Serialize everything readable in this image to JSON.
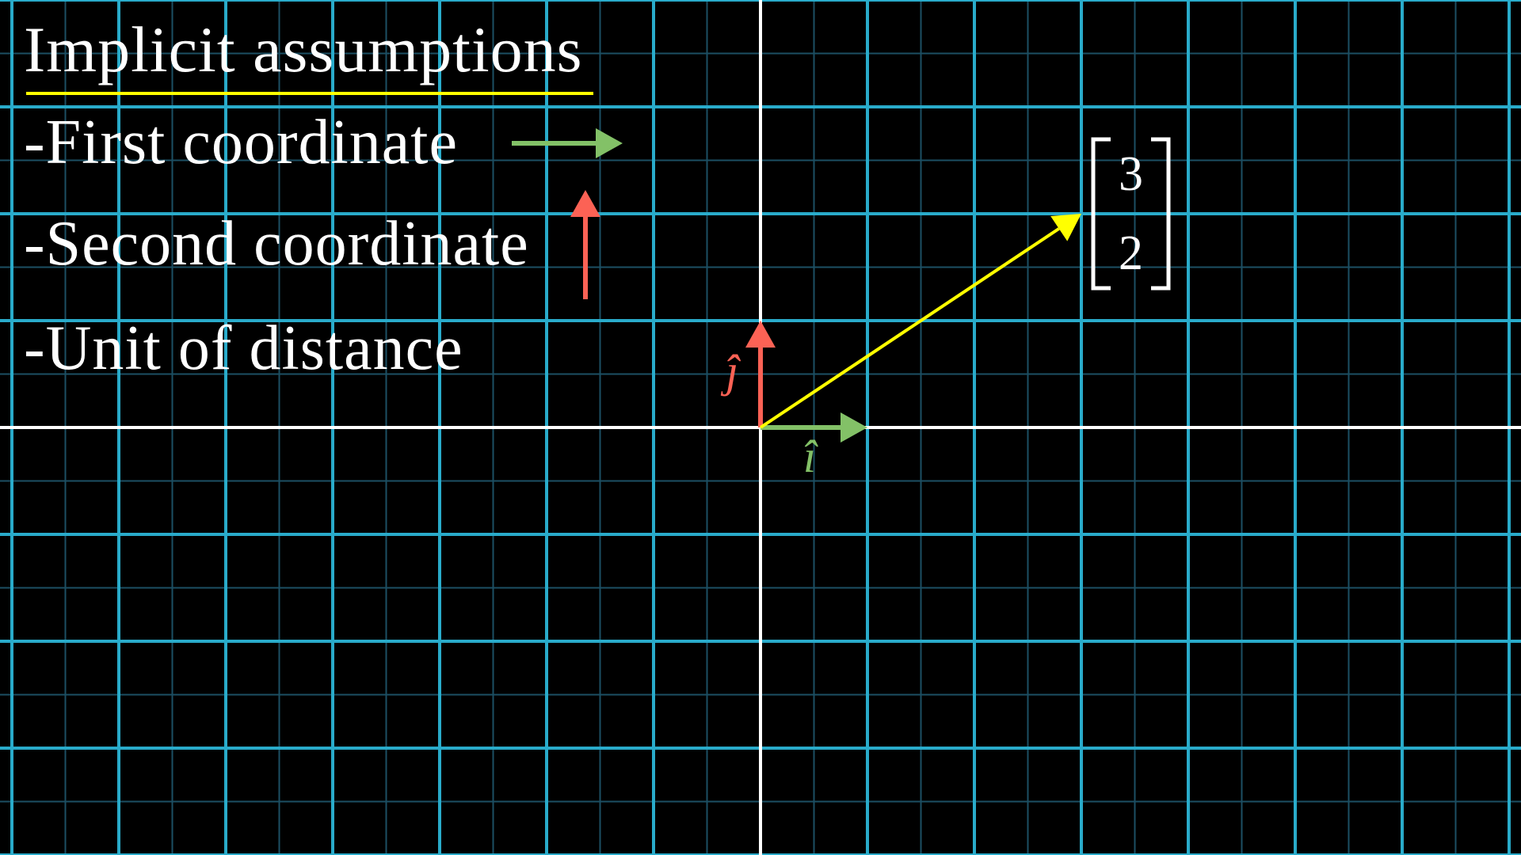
{
  "title": "Implicit assumptions",
  "assumptions": [
    {
      "label": "-First coordinate"
    },
    {
      "label": "-Second coordinate"
    },
    {
      "label": "-Unit of distance"
    }
  ],
  "basis": {
    "i_hat_label": "î",
    "j_hat_label": "ĵ"
  },
  "vector": {
    "x": 3,
    "y": 2,
    "entries": [
      "3",
      "2"
    ]
  },
  "colors": {
    "background": "#000000",
    "grid_major": "#29abca",
    "grid_minor": "#1c4f63",
    "axis": "#ffffff",
    "i_hat": "#83c167",
    "j_hat": "#fc6255",
    "vector": "#ffff00",
    "title_underline": "#ffff00",
    "text": "#ffffff"
  }
}
